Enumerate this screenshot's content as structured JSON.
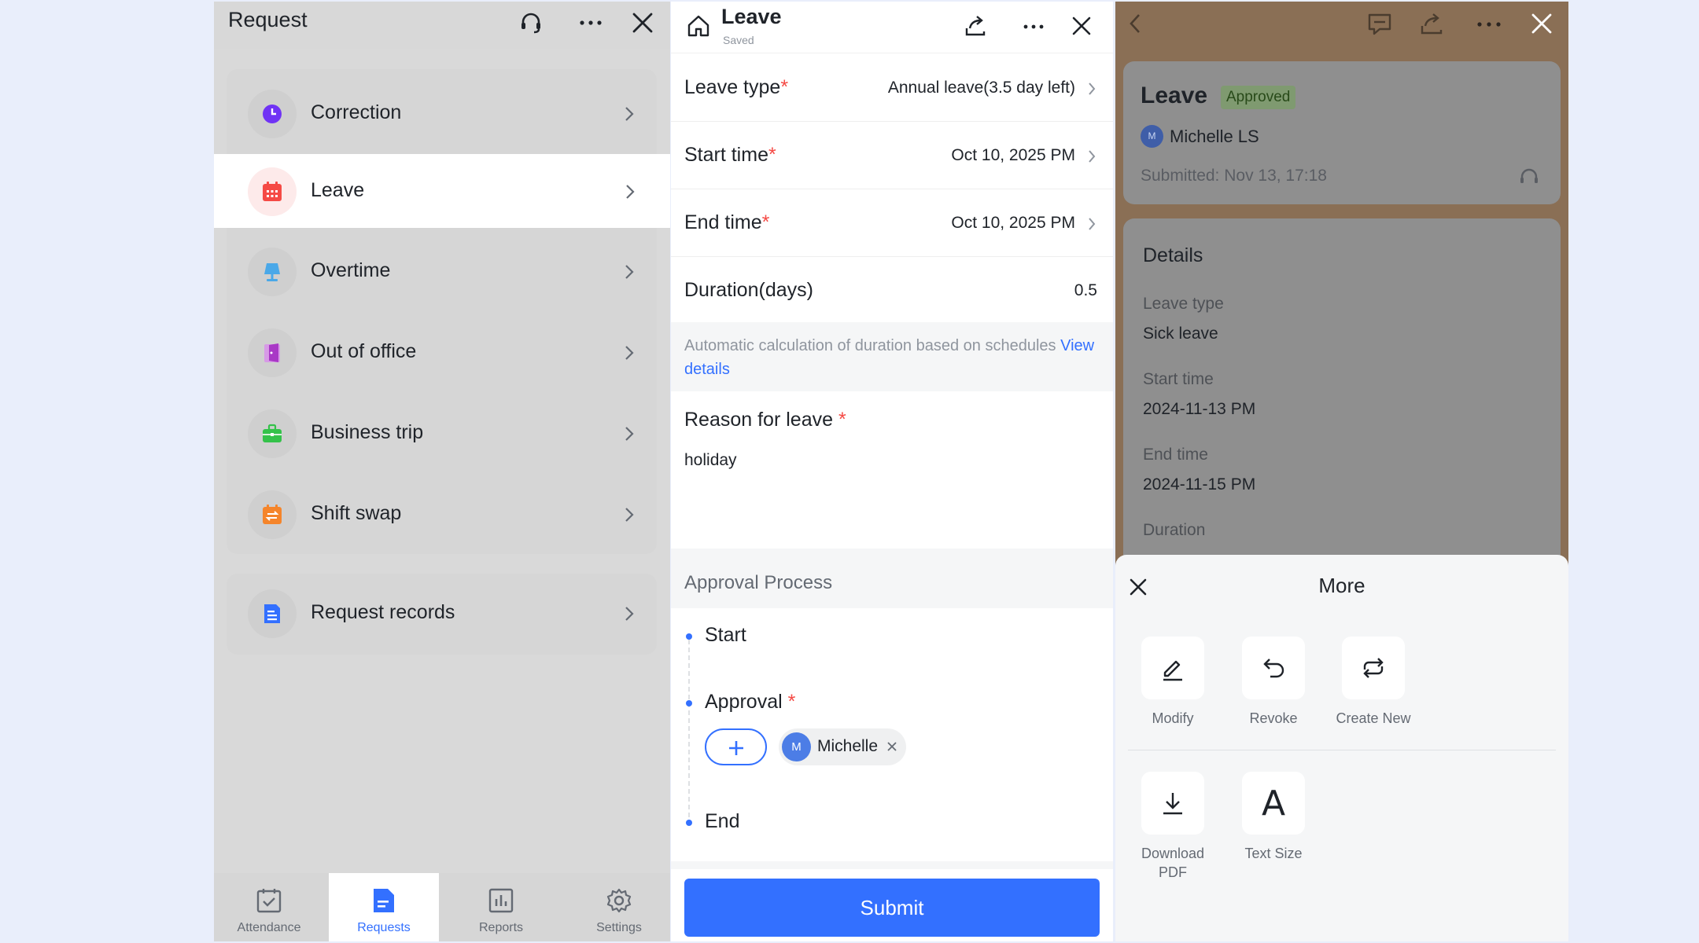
{
  "request_panel": {
    "title": "Request",
    "icons": [
      "headset-icon",
      "more-icon",
      "close-icon"
    ],
    "menu": [
      {
        "label": "Correction",
        "icon": "clock-icon",
        "color": "#7033f5",
        "active": false
      },
      {
        "label": "Leave",
        "icon": "calendar-icon",
        "color": "#f54a45",
        "active": true
      },
      {
        "label": "Overtime",
        "icon": "lamp-icon",
        "color": "#4aa8e8",
        "active": false
      },
      {
        "label": "Out of office",
        "icon": "door-icon",
        "color": "#a938c6",
        "active": false
      },
      {
        "label": "Business trip",
        "icon": "briefcase-icon",
        "color": "#34c24a",
        "active": false
      },
      {
        "label": "Shift swap",
        "icon": "swap-icon",
        "color": "#f5852b",
        "active": false
      }
    ],
    "records": {
      "label": "Request records",
      "icon": "document-icon",
      "color": "#3370ff"
    },
    "tabs": [
      {
        "label": "Attendance",
        "icon": "calendar-check-icon",
        "active": false
      },
      {
        "label": "Requests",
        "icon": "document-icon",
        "active": true
      },
      {
        "label": "Reports",
        "icon": "bar-chart-icon",
        "active": false
      },
      {
        "label": "Settings",
        "icon": "gear-icon",
        "active": false
      }
    ]
  },
  "leave_form": {
    "title": "Leave",
    "subtitle": "Saved",
    "fields": [
      {
        "label": "Leave type",
        "required": "*",
        "value": "Annual leave(3.5 day left)"
      },
      {
        "label": "Start time",
        "required": "*",
        "value": "Oct 10, 2025 PM"
      },
      {
        "label": "End time",
        "required": "*",
        "value": "Oct 10, 2025 PM"
      },
      {
        "label": "Duration(days)",
        "value": "0.5"
      }
    ],
    "hint_text": "Automatic calculation of duration based on schedules",
    "hint_link": "View details",
    "reason_label": "Reason for leave",
    "required_mark": "*",
    "reason_value": "holiday",
    "approval_header": "Approval Process",
    "steps": {
      "start": "Start",
      "approval": "Approval",
      "end": "End"
    },
    "approver": {
      "initial": "M",
      "name": "Michelle"
    },
    "submit_label": "Submit",
    "accent": "#3370ff"
  },
  "leave_detail": {
    "title": "Leave",
    "status": "Approved",
    "user_initial": "M",
    "user": "Michelle LS",
    "submitted": "Submitted: Nov 13, 17:18",
    "details_title": "Details",
    "details": [
      {
        "label": "Leave type",
        "value": "Sick leave"
      },
      {
        "label": "Start time",
        "value": "2024-11-13 PM"
      },
      {
        "label": "End time",
        "value": "2024-11-15 PM"
      },
      {
        "label": "Duration",
        "value": ""
      }
    ],
    "sheet": {
      "title": "More",
      "actions": [
        {
          "label": "Modify",
          "icon": "pencil-icon"
        },
        {
          "label": "Revoke",
          "icon": "undo-icon"
        },
        {
          "label": "Create New",
          "icon": "refresh-icon"
        },
        {
          "label": "Download PDF",
          "icon": "download-icon"
        },
        {
          "label": "Text Size",
          "icon": "text-size-icon",
          "glyph": "A"
        }
      ]
    }
  }
}
